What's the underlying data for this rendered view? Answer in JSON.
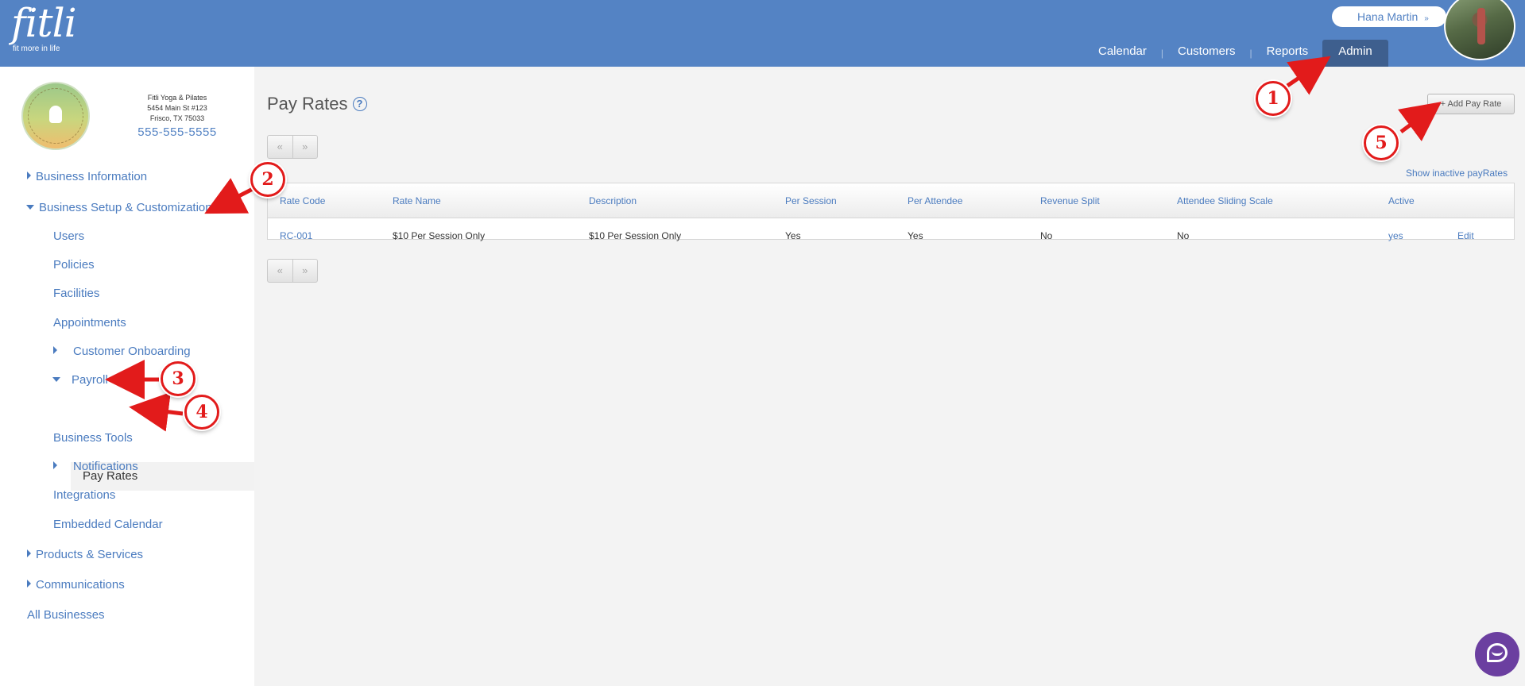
{
  "app": {
    "logo_text": "fitli",
    "logo_tagline": "fit more in life"
  },
  "user": {
    "name": "Hana Martin",
    "chevron": "»"
  },
  "nav": {
    "items": [
      "Calendar",
      "Customers",
      "Reports",
      "Admin"
    ],
    "active": "Admin",
    "separator": "|"
  },
  "business": {
    "name": "Fitli Yoga & Pilates",
    "address1": "5454 Main St #123",
    "address2": "Frisco, TX 75033",
    "phone": "555-555-5555"
  },
  "sidebar": {
    "business_information": "Business Information",
    "business_setup": "Business Setup & Customization",
    "users": "Users",
    "policies": "Policies",
    "facilities": "Facilities",
    "appointments": "Appointments",
    "customer_onboarding": "Customer Onboarding",
    "payroll": "Payroll",
    "pay_rates": "Pay Rates",
    "business_tools": "Business Tools",
    "notifications": "Notifications",
    "integrations": "Integrations",
    "embedded_calendar": "Embedded Calendar",
    "products_services": "Products & Services",
    "communications": "Communications",
    "all_businesses": "All Businesses"
  },
  "page": {
    "title": "Pay Rates",
    "help_glyph": "?",
    "add_button": "+ Add Pay Rate",
    "show_inactive": "Show inactive payRates",
    "pager_prev": "«",
    "pager_next": "»"
  },
  "table": {
    "columns": [
      "Rate Code",
      "Rate Name",
      "Description",
      "Per Session",
      "Per Attendee",
      "Revenue Split",
      "Attendee Sliding Scale",
      "Active"
    ],
    "rows": [
      {
        "rate_code": "RC-001",
        "rate_name": "$10 Per Session Only",
        "description": "$10 Per Session Only",
        "per_session": "Yes",
        "per_attendee": "Yes",
        "revenue_split": "No",
        "sliding_scale": "No",
        "active": "yes",
        "edit": "Edit"
      }
    ]
  },
  "annotations": [
    "1",
    "2",
    "3",
    "4",
    "5"
  ],
  "colors": {
    "header_blue": "#5483c4",
    "active_tab": "#3e5f8e",
    "link_blue": "#4a7bbf",
    "annotation_red": "#e21b1b",
    "chat_purple": "#6b3fa0"
  },
  "icons": {
    "help": "help-circle-icon",
    "chat": "chat-bubble-icon",
    "user_menu_chevron": "chevron-down-icon"
  }
}
